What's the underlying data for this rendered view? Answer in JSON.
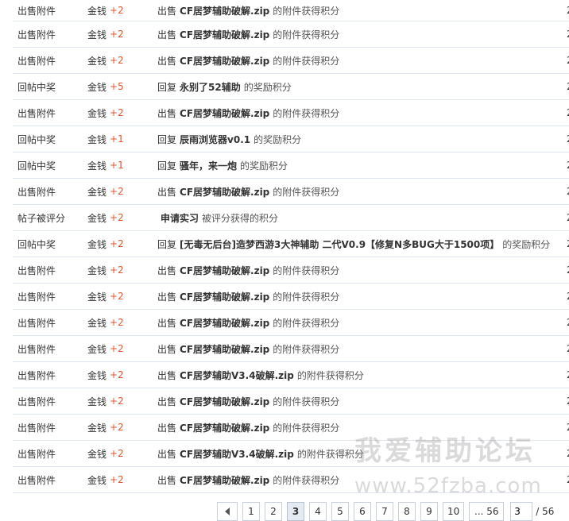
{
  "rows": [
    {
      "type": "出售附件",
      "currency": "金钱",
      "amount": "+2",
      "action": "出售",
      "object": "CF居梦辅助破解.zip",
      "suffix": "的附件获得积分",
      "tail": "2"
    },
    {
      "type": "出售附件",
      "currency": "金钱",
      "amount": "+2",
      "action": "出售",
      "object": "CF居梦辅助破解.zip",
      "suffix": "的附件获得积分",
      "tail": "2"
    },
    {
      "type": "出售附件",
      "currency": "金钱",
      "amount": "+2",
      "action": "出售",
      "object": "CF居梦辅助破解.zip",
      "suffix": "的附件获得积分",
      "tail": "2"
    },
    {
      "type": "回帖中奖",
      "currency": "金钱",
      "amount": "+5",
      "action": "回复",
      "object": "永别了52辅助",
      "suffix": "的奖励积分",
      "tail": "2"
    },
    {
      "type": "出售附件",
      "currency": "金钱",
      "amount": "+2",
      "action": "出售",
      "object": "CF居梦辅助破解.zip",
      "suffix": "的附件获得积分",
      "tail": "2"
    },
    {
      "type": "回帖中奖",
      "currency": "金钱",
      "amount": "+1",
      "action": "回复",
      "object": "辰雨浏览器v0.1",
      "suffix": "的奖励积分",
      "tail": "2"
    },
    {
      "type": "回帖中奖",
      "currency": "金钱",
      "amount": "+1",
      "action": "回复",
      "object": "骚年，来一炮",
      "suffix": "的奖励积分",
      "tail": "2"
    },
    {
      "type": "出售附件",
      "currency": "金钱",
      "amount": "+2",
      "action": "出售",
      "object": "CF居梦辅助破解.zip",
      "suffix": "的附件获得积分",
      "tail": "2"
    },
    {
      "type": "帖子被评分",
      "currency": "金钱",
      "amount": "+2",
      "action": "",
      "object": "申请实习",
      "suffix": "被评分获得的积分",
      "tail": "2"
    },
    {
      "type": "回帖中奖",
      "currency": "金钱",
      "amount": "+2",
      "action": "回复",
      "object": "[无毒无后台]造梦西游3大神辅助 二代V0.9【修复N多BUG大于1500项】",
      "suffix": "的奖励积分",
      "tail": "2"
    },
    {
      "type": "出售附件",
      "currency": "金钱",
      "amount": "+2",
      "action": "出售",
      "object": "CF居梦辅助破解.zip",
      "suffix": "的附件获得积分",
      "tail": "2"
    },
    {
      "type": "出售附件",
      "currency": "金钱",
      "amount": "+2",
      "action": "出售",
      "object": "CF居梦辅助破解.zip",
      "suffix": "的附件获得积分",
      "tail": "2"
    },
    {
      "type": "出售附件",
      "currency": "金钱",
      "amount": "+2",
      "action": "出售",
      "object": "CF居梦辅助破解.zip",
      "suffix": "的附件获得积分",
      "tail": "2"
    },
    {
      "type": "出售附件",
      "currency": "金钱",
      "amount": "+2",
      "action": "出售",
      "object": "CF居梦辅助破解.zip",
      "suffix": "的附件获得积分",
      "tail": "2"
    },
    {
      "type": "出售附件",
      "currency": "金钱",
      "amount": "+2",
      "action": "出售",
      "object": "CF居梦辅助V3.4破解.zip",
      "suffix": "的附件获得积分",
      "tail": "2"
    },
    {
      "type": "出售附件",
      "currency": "金钱",
      "amount": "+2",
      "action": "出售",
      "object": "CF居梦辅助破解.zip",
      "suffix": "的附件获得积分",
      "tail": "2"
    },
    {
      "type": "出售附件",
      "currency": "金钱",
      "amount": "+2",
      "action": "出售",
      "object": "CF居梦辅助破解.zip",
      "suffix": "的附件获得积分",
      "tail": "2"
    },
    {
      "type": "出售附件",
      "currency": "金钱",
      "amount": "+2",
      "action": "出售",
      "object": "CF居梦辅助V3.4破解.zip",
      "suffix": "的附件获得积分",
      "tail": "2"
    },
    {
      "type": "出售附件",
      "currency": "金钱",
      "amount": "+2",
      "action": "出售",
      "object": "CF居梦辅助破解.zip",
      "suffix": "的附件获得积分",
      "tail": "2"
    }
  ],
  "pager": {
    "pages": [
      "1",
      "2",
      "3",
      "4",
      "5",
      "6",
      "7",
      "8",
      "9",
      "10",
      "... 56"
    ],
    "current": "3",
    "jump_value": "3",
    "total": "/ 56"
  },
  "watermark": {
    "line1": "我爱辅助论坛",
    "line2": "www.52fzba.com"
  },
  "colors": {
    "amount": "#e5532b",
    "row_border": "#dfe5ec"
  }
}
